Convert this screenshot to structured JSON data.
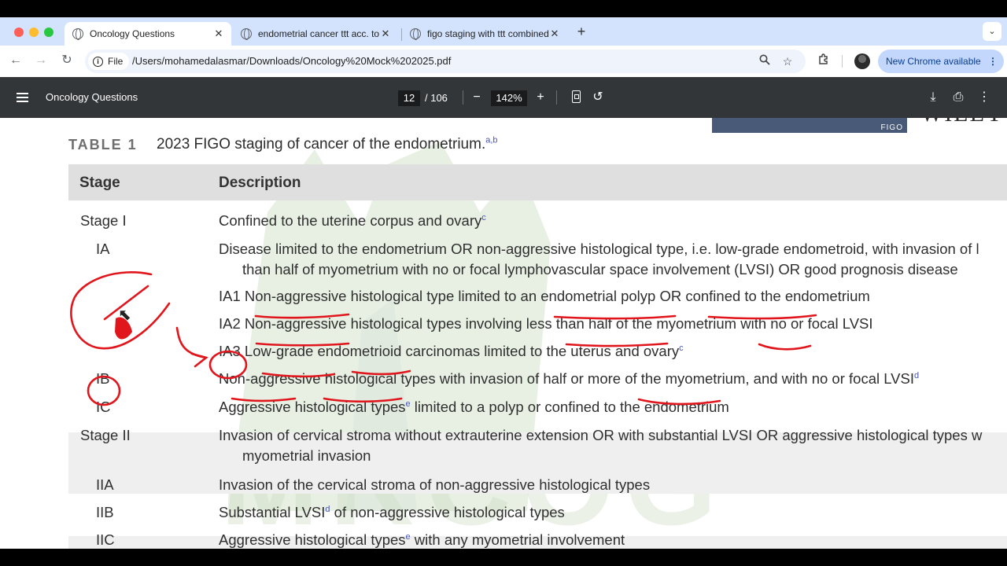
{
  "window": {
    "tabs": [
      {
        "title": "Oncology Questions",
        "close": "✕"
      },
      {
        "title": "endometrial cancer ttt acc. to",
        "close": "✕"
      },
      {
        "title": "figo staging with ttt combined",
        "close": "✕"
      }
    ],
    "new_tab_glyph": "+",
    "tab_menu_glyph": "⌄"
  },
  "toolbar": {
    "back_glyph": "←",
    "forward_glyph": "→",
    "reload_glyph": "↻",
    "file_chip": "File",
    "url": "/Users/mohamedalasmar/Downloads/Oncology%20Mock%202025.pdf",
    "update_label": "New Chrome available",
    "update_menu": "⋮"
  },
  "pdf_viewer": {
    "title": "Oncology Questions",
    "page_current": "12",
    "page_total": "/ 106",
    "zoom": "142%",
    "zoom_out": "−",
    "zoom_in": "+",
    "rotate": "↺",
    "download": "⤓",
    "print": "⎙",
    "more": "⋮"
  },
  "document": {
    "banner_text": "FIGO",
    "publisher_partial": "WILEY",
    "table_label": "TABLE 1",
    "caption": "2023 FIGO staging of cancer of the endometrium.",
    "caption_sup": "a,b",
    "header": {
      "stage": "Stage",
      "description": "Description"
    },
    "rows": [
      {
        "stage": "Stage I",
        "line1": "Confined to the uterine corpus and ovary",
        "sup": "c",
        "line2": "",
        "post": ""
      },
      {
        "stage": "IA",
        "line1": "Disease limited to the endometrium OR non-aggressive histological type, i.e. low-grade endometroid, with invasion of l",
        "sup": "",
        "line2": "than half of myometrium with no or focal lymphovascular space involvement (LVSI) OR good prognosis disease",
        "post": ""
      },
      {
        "stage": "",
        "line1": "IA1 Non-aggressive histological type limited to an endometrial polyp OR confined to the endometrium",
        "sup": "",
        "line2": "",
        "post": ""
      },
      {
        "stage": "",
        "line1": "IA2 Non-aggressive histological types involving less than half of the myometrium with no or focal LVSI",
        "sup": "",
        "line2": "",
        "post": ""
      },
      {
        "stage": "",
        "line1": "IA3 Low-grade endometrioid carcinomas limited to the uterus and ovary",
        "sup": "c",
        "line2": "",
        "post": ""
      },
      {
        "stage": "IB",
        "line1": "Non-aggressive histological types with invasion of half or more of the myometrium, and with no or focal LVSI",
        "sup": "d",
        "line2": "",
        "post": ""
      },
      {
        "stage": "IC",
        "line1": "Aggressive histological types",
        "sup": "e",
        "line2": "",
        "post": " limited to a polyp or confined to the endometrium"
      },
      {
        "stage": "Stage II",
        "line1": "Invasion of cervical stroma without extrauterine extension OR with substantial LVSI OR aggressive histological types w",
        "sup": "",
        "line2": "myometrial invasion",
        "post": ""
      },
      {
        "stage": "IIA",
        "line1": "Invasion of the cervical stroma of non-aggressive histological types",
        "sup": "",
        "line2": "",
        "post": ""
      },
      {
        "stage": "IIB",
        "line1": "Substantial LVSI",
        "sup": "d",
        "line2": "",
        "post": " of non-aggressive histological types"
      },
      {
        "stage": "IIC",
        "line1": "Aggressive histological types",
        "sup": "e",
        "line2": "",
        "post": " with any myometrial involvement"
      }
    ],
    "watermark": "MRCOG"
  },
  "colors": {
    "tabstrip": "#d3e3fd",
    "pdf_toolbar": "#323639",
    "annotation_ink": "#e0161c",
    "update_chip": "#c2d7fb"
  }
}
